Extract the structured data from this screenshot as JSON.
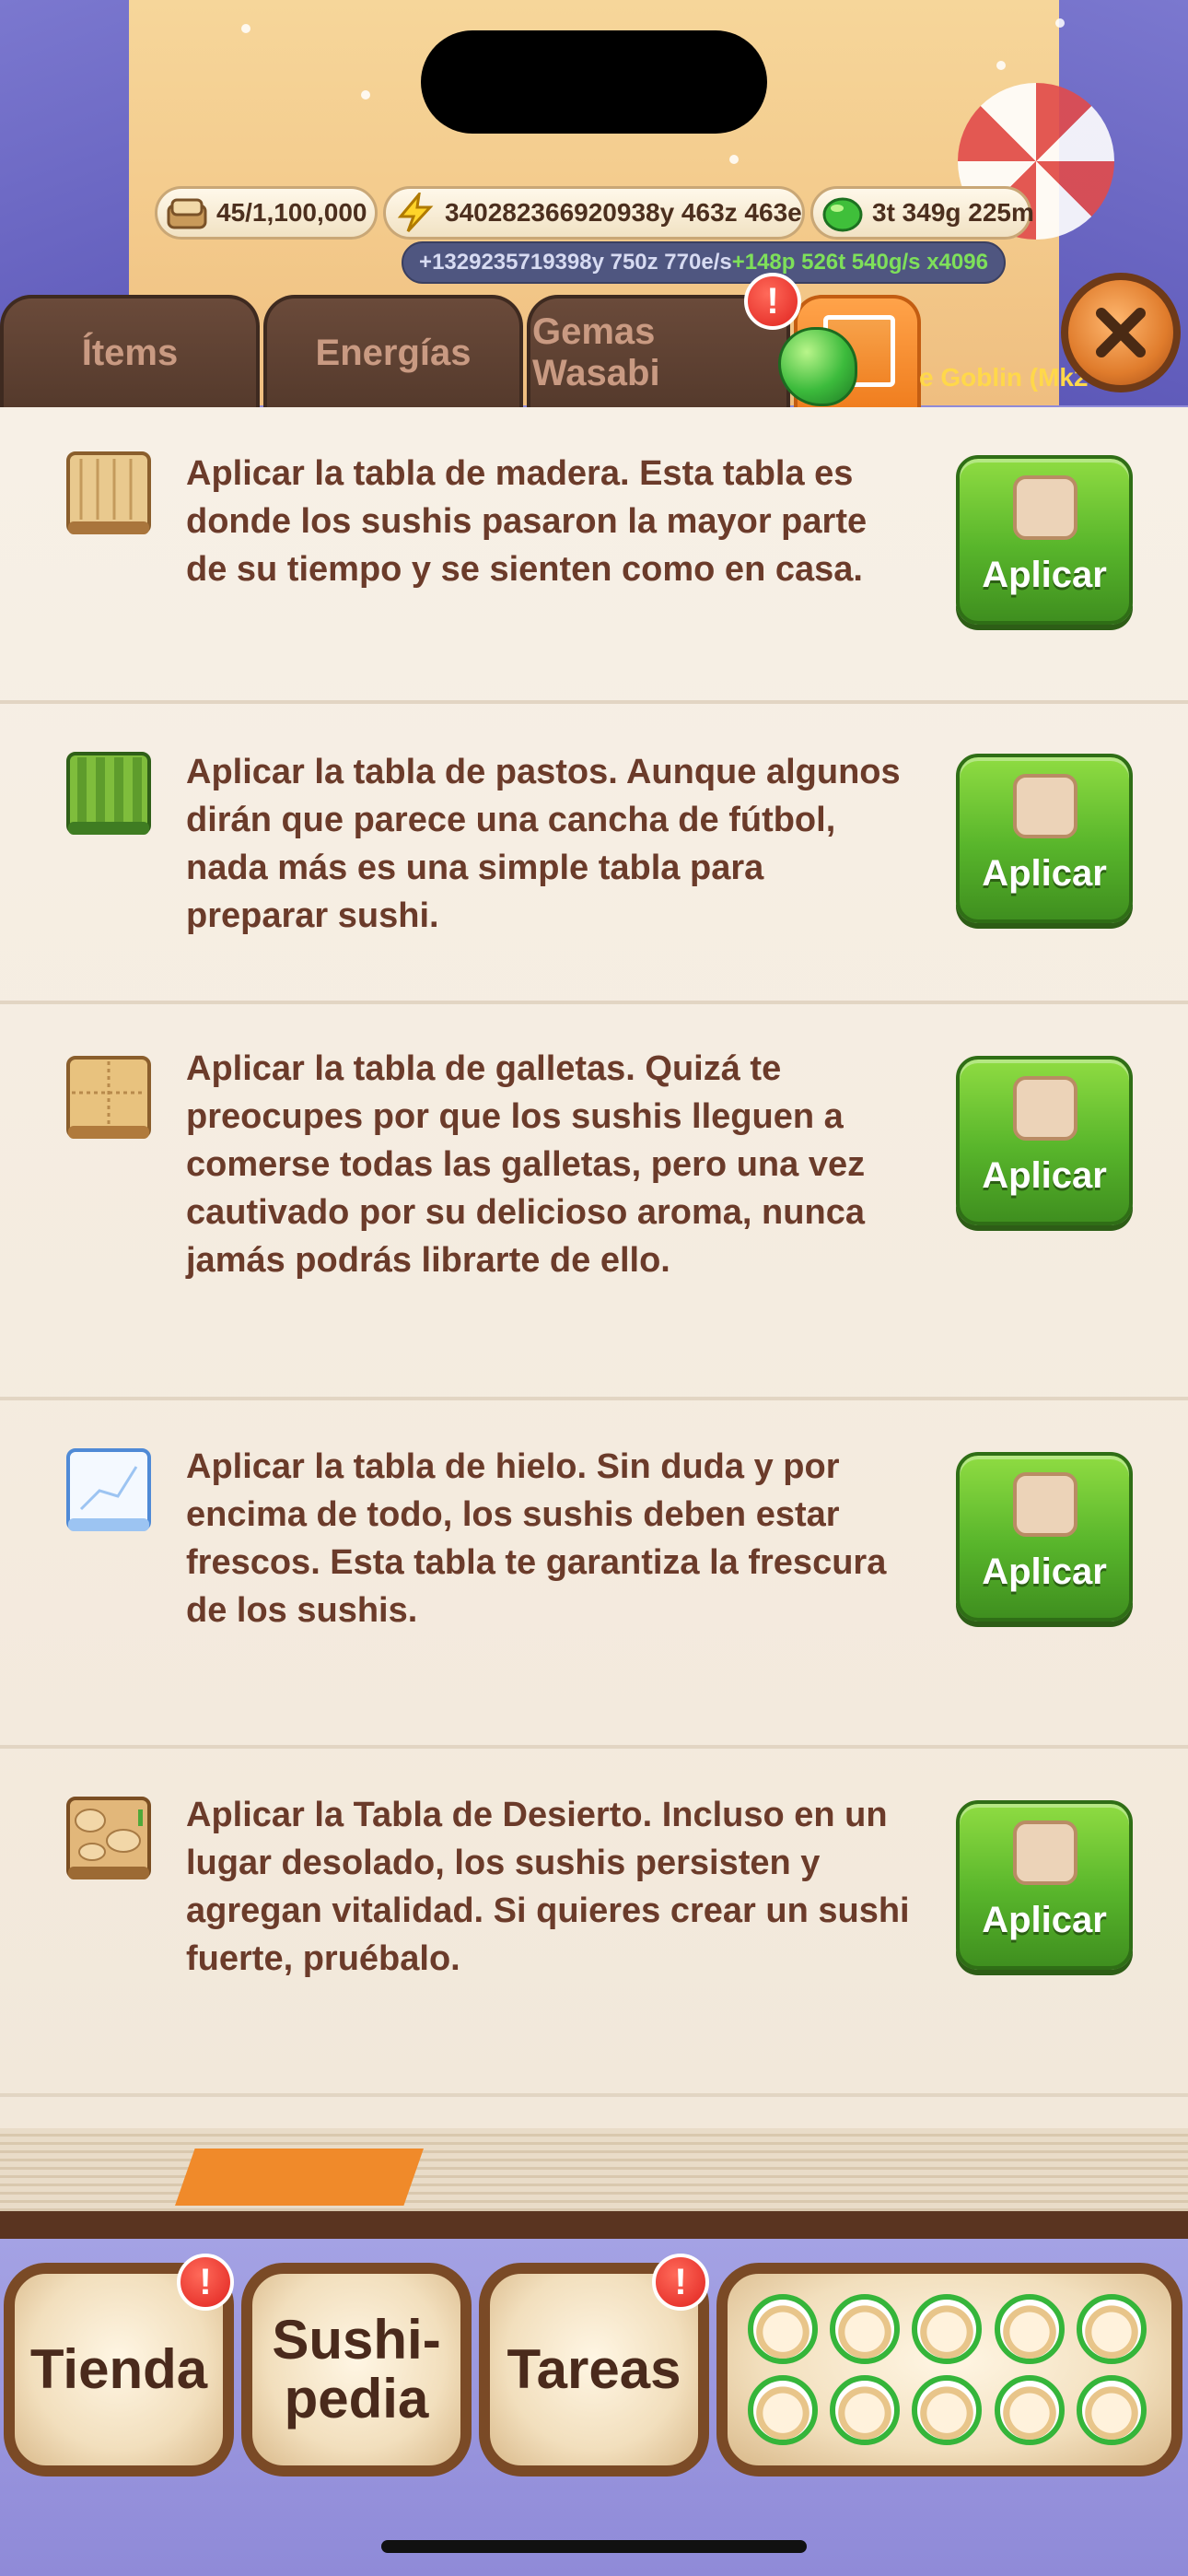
{
  "resources": {
    "boards": "45/1,100,000",
    "energy": "34028236692093​8y 463z 463e",
    "gems": "3t 349g 225m"
  },
  "rates": {
    "energy_rate": "+1329235719398y 750z 770e/s",
    "gem_rate": "+148p 526t 540g/s x4096"
  },
  "tabs": {
    "items": "Ítems",
    "energias": "Energías",
    "gemas": "Gemas Wasabi",
    "goblin": "e Goblin (Mk2"
  },
  "alerts": {
    "mark": "!"
  },
  "apply_label": "Aplicar",
  "boards": [
    {
      "icon": "wood-board-icon",
      "description": "Aplicar la tabla de madera. Esta tabla es donde los sushis pasaron la mayor parte de su tiempo y se sienten como en casa."
    },
    {
      "icon": "grass-board-icon",
      "description": "Aplicar la tabla de pastos. Aunque algunos dirán que parece una cancha de fútbol, nada más es una simple tabla para preparar sushi."
    },
    {
      "icon": "cookie-board-icon",
      "description": "Aplicar la tabla de galletas. Quizá te preocupes por que los sushis lleguen a comerse todas las galletas, pero una vez cautivado por su delicioso aroma, nunca jamás podrás librarte de ello."
    },
    {
      "icon": "ice-board-icon",
      "description": "Aplicar la tabla de hielo. Sin duda y por encima de todo, los sushis deben estar frescos. Esta tabla te garantiza la frescura de los sushis."
    },
    {
      "icon": "desert-board-icon",
      "description": "Aplicar la Tabla de Desierto. Incluso en un lugar desolado, los sushis persisten y agregan vitalidad. Si quieres crear un sushi fuerte, pruébalo."
    }
  ],
  "bottom_nav": {
    "tienda": "Tienda",
    "sushipedia_1": "Sushi-",
    "sushipedia_2": "pedia",
    "tareas": "Tareas"
  }
}
